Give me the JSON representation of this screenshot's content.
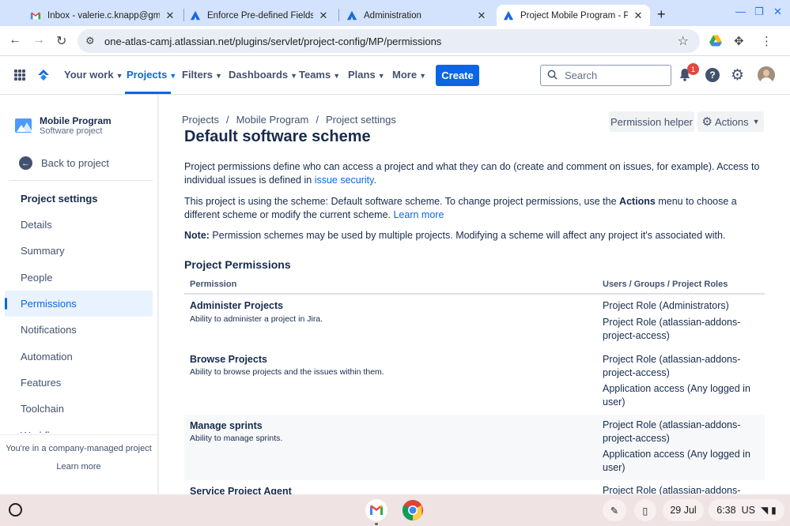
{
  "browser": {
    "tabs": [
      {
        "title": "Inbox - valerie.c.knapp@gmail.c",
        "icon": "gmail-icon"
      },
      {
        "title": "Enforce Pre-defined Fields Entr",
        "icon": "jira-icon"
      },
      {
        "title": "Administration",
        "icon": "jira-icon"
      },
      {
        "title": "Project Mobile Program - Projec",
        "icon": "jira-icon"
      }
    ],
    "new_tab_label": "+",
    "url": "one-atlas-camj.atlassian.net/plugins/servlet/project-config/MP/permissions"
  },
  "topnav": {
    "items": [
      "Your work",
      "Projects",
      "Filters",
      "Dashboards",
      "Teams",
      "Plans",
      "More"
    ],
    "active_item": "Projects",
    "create_label": "Create",
    "search_placeholder": "Search",
    "notification_count": "1",
    "help_label": "?"
  },
  "sidebar": {
    "project_name": "Mobile Program",
    "project_type": "Software project",
    "back_label": "Back to project",
    "heading": "Project settings",
    "items": [
      "Details",
      "Summary",
      "People",
      "Permissions",
      "Notifications",
      "Automation",
      "Features",
      "Toolchain",
      "Workflows"
    ],
    "active_item": "Permissions",
    "footer_text": "You're in a company-managed project",
    "footer_link": "Learn more"
  },
  "main": {
    "breadcrumbs": [
      "Projects",
      "Mobile Program",
      "Project settings"
    ],
    "breadcrumb_sep": "/",
    "permission_helper_label": "Permission helper",
    "actions_label": "Actions",
    "title": "Default software scheme",
    "intro": {
      "text": "Project permissions define who can access a project and what they can do (create and comment on issues, for example). Access to individual issues is defined in ",
      "link": "issue security",
      "end": "."
    },
    "scheme_info": {
      "text1": "This project is using the scheme: Default software scheme. To change project permissions, use the ",
      "bold": "Actions",
      "text2": " menu to choose a different scheme or modify the current scheme. ",
      "link": "Learn more"
    },
    "note": {
      "label": "Note:",
      "text": " Permission schemes may be used by multiple projects. Modifying a scheme will affect any project it's associated with."
    },
    "section_title": "Project Permissions",
    "table": {
      "headers": [
        "Permission",
        "Users / Groups / Project Roles"
      ],
      "rows": [
        {
          "name": "Administer Projects",
          "desc": "Ability to administer a project in Jira.",
          "holders": [
            "Project Role (Administrators)",
            "Project Role (atlassian-addons-project-access)"
          ]
        },
        {
          "name": "Browse Projects",
          "desc": "Ability to browse projects and the issues within them.",
          "holders": [
            "Project Role (atlassian-addons-project-access)",
            "Application access (Any logged in user)"
          ]
        },
        {
          "name": "Manage sprints",
          "desc": "Ability to manage sprints.",
          "holders": [
            "Project Role (atlassian-addons-project-access)",
            "Application access (Any logged in user)"
          ]
        },
        {
          "name": "Service Project Agent",
          "desc": "",
          "holders": [
            "Project Role (atlassian-addons-project-access)"
          ]
        }
      ]
    }
  },
  "shelf": {
    "date": "29 Jul",
    "time": "6:38",
    "locale": "US"
  },
  "colors": {
    "jira_blue": "#0c66e4",
    "tabstrip": "#d3e3fd",
    "shelf": "#f0e3e3"
  }
}
